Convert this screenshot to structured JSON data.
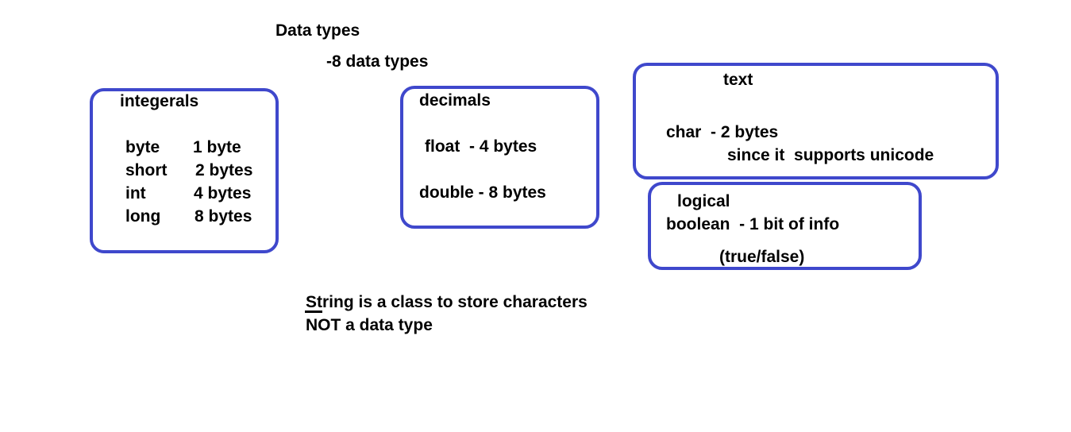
{
  "title": "Data types",
  "subtitle": "-8 data types",
  "accent_color": "#3f48cc",
  "integerals": {
    "heading": "integerals",
    "rows": [
      {
        "type": "byte",
        "size": "1 byte"
      },
      {
        "type": "short",
        "size": "2 bytes"
      },
      {
        "type": "int",
        "size": "4 bytes"
      },
      {
        "type": "long",
        "size": "8 bytes"
      }
    ]
  },
  "decimals": {
    "heading": "decimals",
    "rows": [
      "float  - 4 bytes",
      "double - 8 bytes"
    ]
  },
  "text": {
    "heading": "text",
    "line1": "char  - 2 bytes",
    "line2": "since it  supports unicode"
  },
  "logical": {
    "heading": "logical",
    "line1": "boolean  - 1 bit of info",
    "line2": "(true/false)"
  },
  "note": {
    "line1": "String is a class to store characters",
    "line2": "NOT a data type"
  }
}
